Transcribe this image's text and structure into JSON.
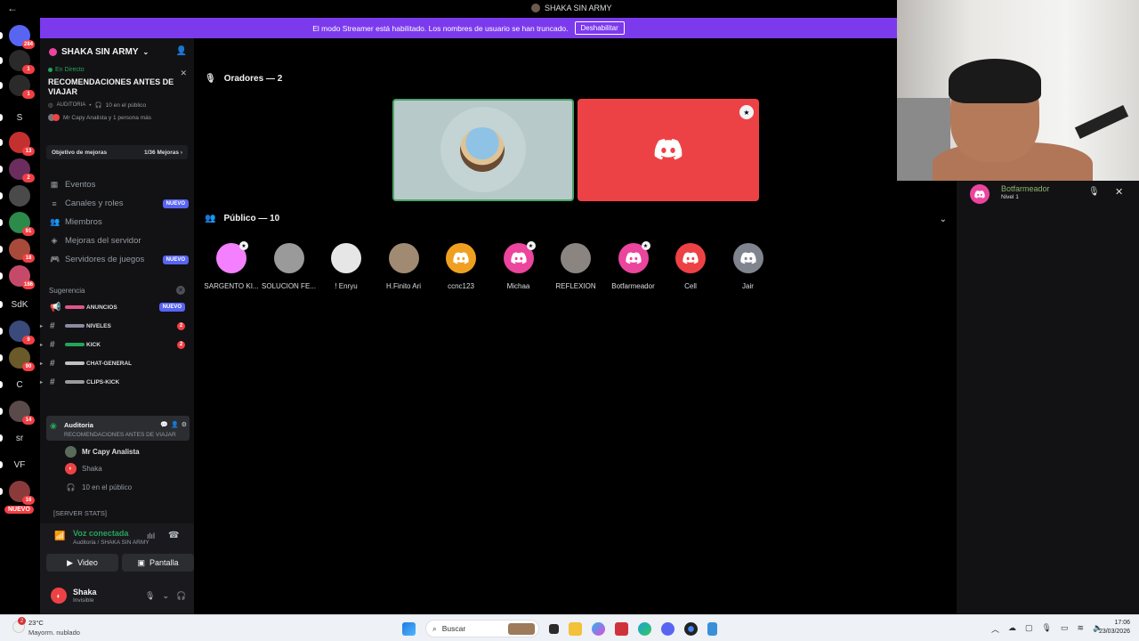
{
  "window": {
    "title": "SHAKA SIN ARMY",
    "back_icon": "arrow-left-icon"
  },
  "banner": {
    "text": "El modo Streamer está habilitado. Los nombres de usuario se han truncado.",
    "button": "Deshabilitar"
  },
  "rail": {
    "servers": [
      {
        "label": "",
        "badge": "284"
      },
      {
        "label": "",
        "badge": "1"
      },
      {
        "label": "",
        "badge": "1"
      },
      {
        "label": "S",
        "badge": ""
      },
      {
        "label": "",
        "badge": "13"
      },
      {
        "label": "",
        "badge": "2"
      },
      {
        "label": "",
        "badge": ""
      },
      {
        "label": "",
        "badge": "91"
      },
      {
        "label": "",
        "badge": "18"
      },
      {
        "label": "",
        "badge": "186"
      },
      {
        "label": "SdK",
        "badge": ""
      },
      {
        "label": "",
        "badge": "9"
      },
      {
        "label": "",
        "badge": "90"
      },
      {
        "label": "C",
        "badge": ""
      },
      {
        "label": "",
        "badge": "14"
      },
      {
        "label": "sr",
        "badge": ""
      },
      {
        "label": "VF",
        "badge": ""
      },
      {
        "label": "",
        "badge": "16"
      }
    ],
    "new_label": "NUEVO"
  },
  "sidebar": {
    "server_name": "SHAKA SIN ARMY",
    "stage": {
      "live": "En Directo",
      "topic": "RECOMENDACIONES ANTES DE VIAJAR",
      "channel": "Auditoria",
      "audience": "10 en el público",
      "speakers": "Mr Capy Analista y 1 persona más"
    },
    "goal": {
      "label": "Objetivo de mejoras",
      "value": "1/36 Mejoras"
    },
    "menu": [
      {
        "label": "Eventos",
        "icon": "calendar-icon",
        "badge": ""
      },
      {
        "label": "Canales y roles",
        "icon": "channels-icon",
        "badge": "NUEVO"
      },
      {
        "label": "Miembros",
        "icon": "members-icon",
        "badge": ""
      },
      {
        "label": "Mejoras del servidor",
        "icon": "boost-icon",
        "badge": ""
      },
      {
        "label": "Servidores de juegos",
        "icon": "gamepad-icon",
        "badge": "NUEVO"
      }
    ],
    "suggestion": "Sugerencia",
    "channels": [
      {
        "label": "ANUNCIOS",
        "badge": "NUEVO",
        "count": ""
      },
      {
        "label": "NIVELES",
        "badge": "",
        "count": "2"
      },
      {
        "label": "KICK",
        "badge": "",
        "count": "2"
      },
      {
        "label": "CHAT-GENERAL",
        "badge": "",
        "count": ""
      },
      {
        "label": "CLIPS-KICK",
        "badge": "",
        "count": ""
      }
    ],
    "voice_channel": {
      "name": "Auditoria",
      "topic": "RECOMENDACIONES ANTES DE VIAJAR"
    },
    "voice_members": [
      {
        "name": "Mr Capy Analista"
      },
      {
        "name": "Shaka"
      },
      {
        "name": "10 en el público"
      }
    ],
    "stats": "[SERVER STATS]",
    "connection": {
      "status": "Voz conectada",
      "location": "Auditoria / SHAKA SIN ARMY",
      "video": "Video",
      "screen": "Pantalla"
    },
    "user": {
      "name": "Shaka",
      "status": "Invisible"
    }
  },
  "stage": {
    "speakers_title": "Oradores — 2",
    "audience_title": "Público — 10",
    "audience": [
      {
        "name": "SARGENTO KI...",
        "color": "#f47fff",
        "mod": true
      },
      {
        "name": "SOLUCION FE...",
        "color": "#9a9a9a",
        "mod": false
      },
      {
        "name": "! Enryu",
        "color": "#e6e6e6",
        "mod": false
      },
      {
        "name": "H.Finito Ari",
        "color": "#a08a72",
        "mod": false
      },
      {
        "name": "ccnc123",
        "color": "#f0a020",
        "mod": false
      },
      {
        "name": "Michaa",
        "color": "#eb459e",
        "mod": true
      },
      {
        "name": "REFLEXION",
        "color": "#8a8580",
        "mod": false
      },
      {
        "name": "Botfarmeador",
        "color": "#eb459e",
        "mod": true
      },
      {
        "name": "Cell",
        "color": "#ed4245",
        "mod": false
      },
      {
        "name": "Jair",
        "color": "#80848e",
        "mod": false
      }
    ]
  },
  "right_panel": {
    "bot_name": "Botfarmeador",
    "bot_level": "Nivel 1"
  },
  "taskbar": {
    "weather_temp": "23°C",
    "weather_cond": "Mayorm. nublado",
    "weather_badge": "2",
    "search": "Buscar",
    "time": "17:06",
    "date": "23/03/2026"
  },
  "colors": {
    "accent": "#5865f2",
    "banner": "#7c3aed",
    "danger": "#ed4245",
    "online": "#23a559"
  }
}
